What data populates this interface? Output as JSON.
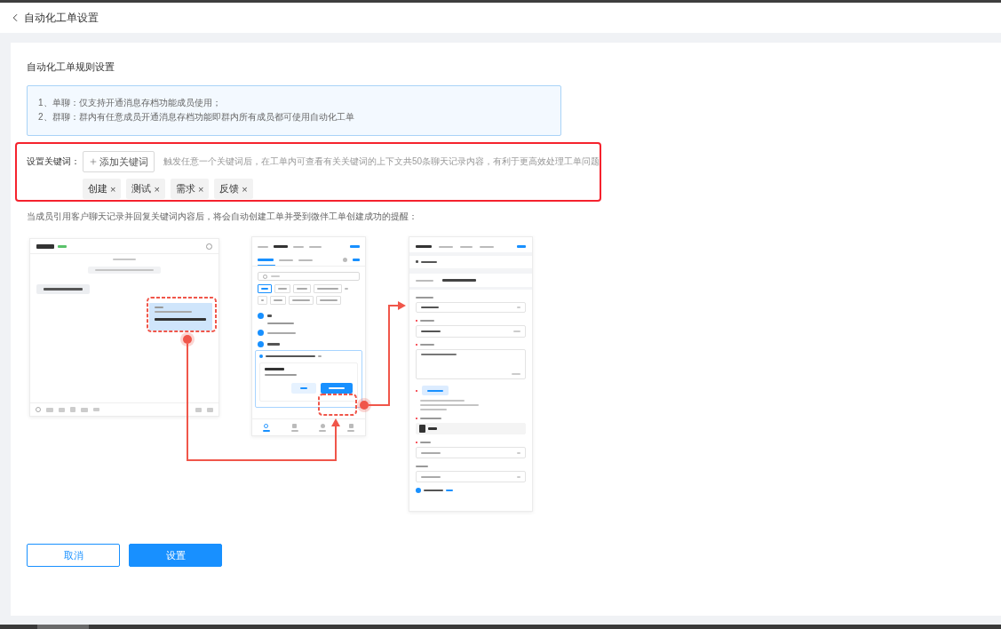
{
  "header": {
    "title": "自动化工单设置"
  },
  "section": {
    "title": "自动化工单规则设置"
  },
  "notice": {
    "lines": [
      "1、单聊：仅支持开通消息存档功能成员使用；",
      "2、群聊：群内有任意成员开通消息存档功能即群内所有成员都可使用自动化工单"
    ]
  },
  "keywords": {
    "label": "设置关键词：",
    "add_button": "添加关键词",
    "hint": "触发任意一个关键词后，在工单内可查看有关关键词的上下文共50条聊天记录内容，有利于更高效处理工单问题",
    "tags": [
      {
        "label": "创建",
        "remove": "×"
      },
      {
        "label": "测试",
        "remove": "×"
      },
      {
        "label": "需求",
        "remove": "×"
      },
      {
        "label": "反馈",
        "remove": "×"
      }
    ]
  },
  "description": "当成员引用客户聊天记录并回复关键词内容后，将会自动创建工单并受到微伴工单创建成功的提醒：",
  "buttons": [
    {
      "label": "取消",
      "kind": "secondary"
    },
    {
      "label": "设置",
      "kind": "primary"
    }
  ]
}
